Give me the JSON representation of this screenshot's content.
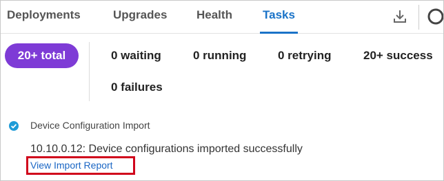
{
  "tabs": [
    {
      "label": "Deployments",
      "active": false
    },
    {
      "label": "Upgrades",
      "active": false
    },
    {
      "label": "Health",
      "active": false
    },
    {
      "label": "Tasks",
      "active": true
    }
  ],
  "toolbar": {
    "download_icon": "download-icon",
    "search_icon": "search-icon"
  },
  "summary": {
    "total": "20+ total",
    "waiting": "0 waiting",
    "running": "0 running",
    "retrying": "0 retrying",
    "success": "20+ success",
    "failures": "0 failures"
  },
  "task": {
    "status_icon": "check-circle-icon",
    "title": "Device Configuration Import",
    "message": "10.10.0.12: Device configurations imported successfully",
    "link": "View Import Report"
  },
  "colors": {
    "accent": "#1a73c8",
    "total_pill": "#7e3bd6",
    "success_check": "#1e9bd7",
    "highlight_border": "#d0021b"
  }
}
